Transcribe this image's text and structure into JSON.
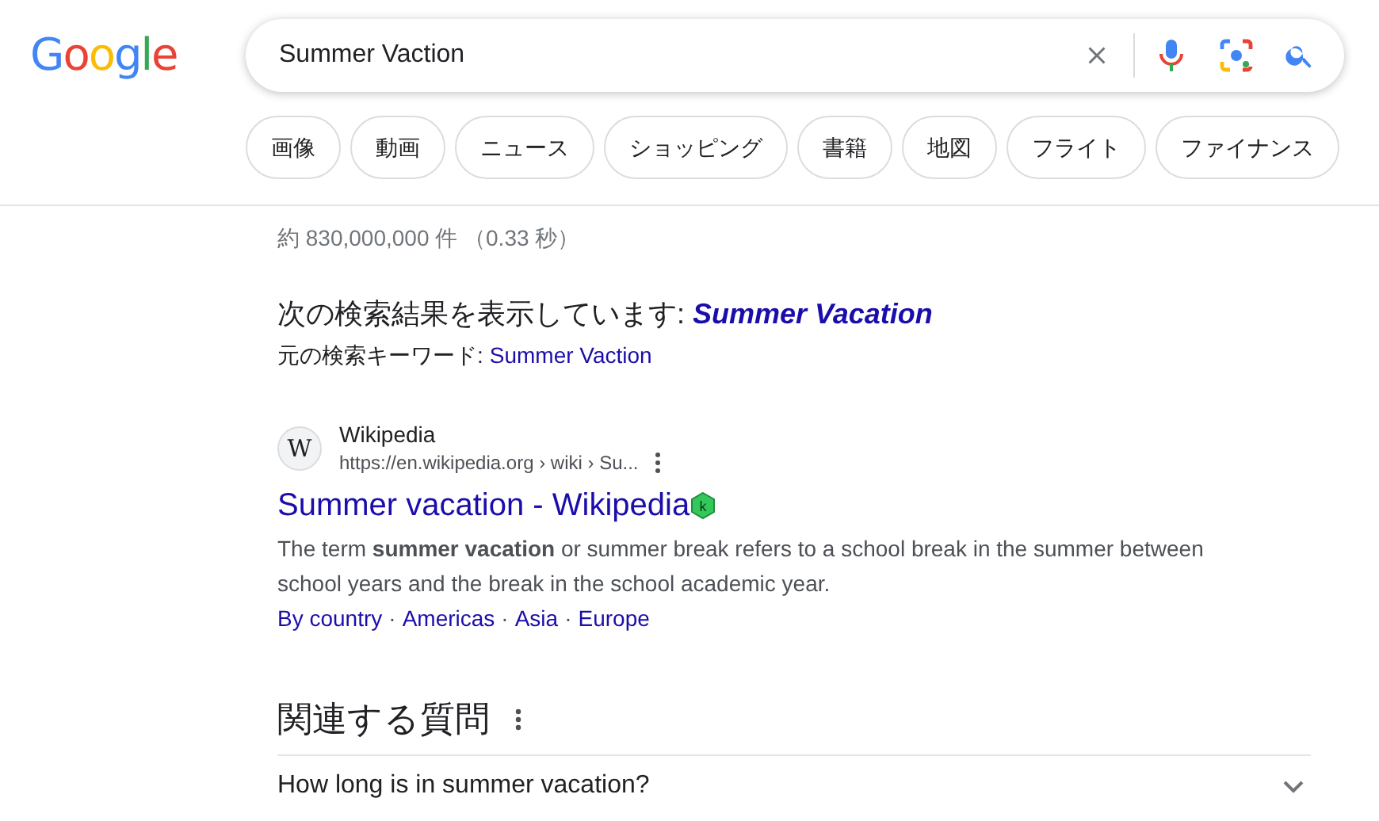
{
  "logo": "Google",
  "search": {
    "value": "Summer Vaction"
  },
  "chips": [
    {
      "label": "画像",
      "selected": false
    },
    {
      "label": "動画",
      "selected": false
    },
    {
      "label": "ニュース",
      "selected": false
    },
    {
      "label": "ショッピング",
      "selected": false
    },
    {
      "label": "書籍",
      "selected": false
    },
    {
      "label": "地図",
      "selected": false
    },
    {
      "label": "フライト",
      "selected": false
    },
    {
      "label": "ファイナンス",
      "selected": false
    }
  ],
  "result_stats": "約 830,000,000 件 （0.33 秒）",
  "spelling": {
    "label": "次の検索結果を表示しています:",
    "corrected": "Summer Vacation",
    "original_label": "元の検索キーワード:",
    "original": "Summer Vaction"
  },
  "results": [
    {
      "favicon": "W",
      "site": "Wikipedia",
      "url": "https://en.wikipedia.org › wiki › Su...",
      "title": "Summer vacation - Wikipedia",
      "badge": "k",
      "snippet": "The term **summer vacation** or summer break refers to a school break in the summer between school years and the break in the school academic year.",
      "links": [
        "By country",
        "Americas",
        "Asia",
        "Europe"
      ],
      "separator": "·"
    }
  ],
  "related": {
    "title": "関連する質問",
    "questions": [
      {
        "text": "How long is in summer vacation?",
        "expanded": false
      }
    ]
  }
}
